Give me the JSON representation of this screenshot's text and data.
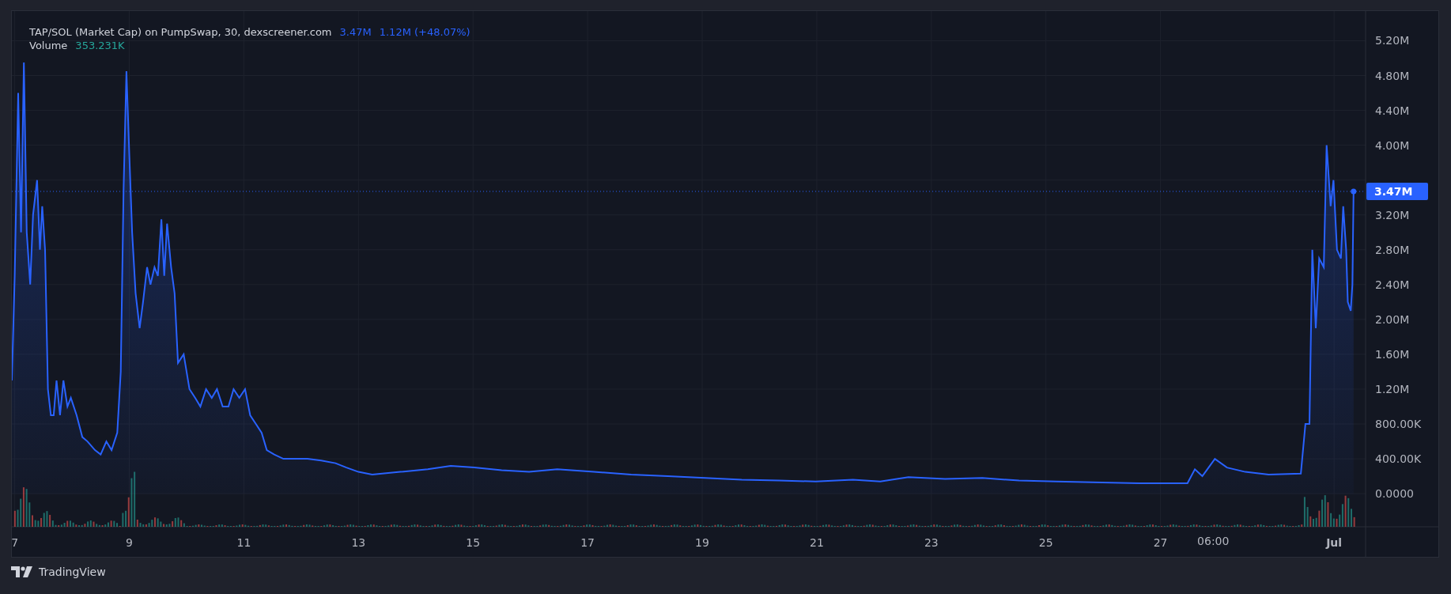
{
  "legend": {
    "title": "TAP/SOL (Market Cap) on PumpSwap, 30, dexscreener.com",
    "last_value": "3.47M",
    "change": "1.12M (+48.07%)",
    "volume_label": "Volume",
    "volume_value": "353.231K"
  },
  "chart": {
    "price_badge": "3.47M",
    "session_label": "06:00",
    "chart_data": {
      "type": "area",
      "grid": true,
      "xlim": [
        6.95,
        31.85
      ],
      "ylim": [
        -380000,
        5540000
      ],
      "x": [
        6.95,
        7,
        7.06,
        7.11,
        7.16,
        7.21,
        7.27,
        7.32,
        7.39,
        7.44,
        7.48,
        7.53,
        7.58,
        7.63,
        7.68,
        7.73,
        7.79,
        7.85,
        7.92,
        7.98,
        8.08,
        8.18,
        8.27,
        8.4,
        8.5,
        8.6,
        8.69,
        8.79,
        8.85,
        8.9,
        8.95,
        9,
        9.05,
        9.11,
        9.18,
        9.24,
        9.31,
        9.37,
        9.44,
        9.5,
        9.56,
        9.61,
        9.66,
        9.73,
        9.79,
        9.85,
        9.95,
        10.05,
        10.15,
        10.24,
        10.34,
        10.44,
        10.53,
        10.63,
        10.73,
        10.82,
        10.92,
        11.02,
        11.11,
        11.21,
        11.31,
        11.4,
        11.53,
        11.69,
        11.89,
        12.11,
        12.35,
        12.6,
        12.79,
        13,
        13.24,
        13.73,
        14.21,
        14.61,
        15.02,
        15.5,
        15.98,
        16.47,
        17.11,
        17.76,
        18.4,
        19.05,
        19.69,
        20.34,
        20.98,
        21.63,
        22.11,
        22.6,
        23.24,
        23.89,
        24.53,
        25.18,
        25.82,
        26.63,
        27.47,
        27.6,
        27.73,
        27.95,
        28.16,
        28.48,
        28.89,
        29.45,
        29.53,
        29.6,
        29.65,
        29.71,
        29.77,
        29.85,
        29.9,
        29.97,
        30.02,
        30.08,
        30.15,
        30.19,
        30.24,
        30.27,
        30.32,
        30.35,
        30.37
      ],
      "series": [
        {
          "color": "#2962ff",
          "values": [
            1300000,
            2500000,
            4600000,
            3000000,
            4950000,
            3000000,
            2400000,
            3200000,
            3600000,
            2800000,
            3300000,
            2800000,
            1200000,
            900000,
            900000,
            1300000,
            900000,
            1300000,
            1000000,
            1100000,
            900000,
            650000,
            600000,
            500000,
            450000,
            600000,
            500000,
            700000,
            1400000,
            3500000,
            4850000,
            3900000,
            3000000,
            2300000,
            1900000,
            2200000,
            2600000,
            2400000,
            2600000,
            2500000,
            3150000,
            2500000,
            3100000,
            2600000,
            2300000,
            1500000,
            1600000,
            1200000,
            1100000,
            1000000,
            1200000,
            1100000,
            1200000,
            1000000,
            1000000,
            1200000,
            1100000,
            1200000,
            900000,
            800000,
            700000,
            500000,
            450000,
            400000,
            400000,
            400000,
            380000,
            350000,
            300000,
            250000,
            220000,
            250000,
            280000,
            320000,
            300000,
            270000,
            250000,
            280000,
            250000,
            220000,
            200000,
            180000,
            160000,
            150000,
            140000,
            160000,
            140000,
            190000,
            170000,
            180000,
            150000,
            140000,
            130000,
            120000,
            120000,
            280000,
            200000,
            400000,
            300000,
            250000,
            220000,
            230000,
            800000,
            800000,
            2800000,
            1900000,
            2700000,
            2600000,
            4000000,
            3300000,
            3600000,
            2800000,
            2700000,
            3300000,
            2800000,
            2200000,
            2100000,
            2400000,
            3470000
          ]
        }
      ],
      "xticks": [
        {
          "value": 7,
          "label": "7"
        },
        {
          "value": 9,
          "label": "9"
        },
        {
          "value": 11,
          "label": "11"
        },
        {
          "value": 13,
          "label": "13"
        },
        {
          "value": 15,
          "label": "15"
        },
        {
          "value": 17,
          "label": "17"
        },
        {
          "value": 19,
          "label": "19"
        },
        {
          "value": 21,
          "label": "21"
        },
        {
          "value": 23,
          "label": "23"
        },
        {
          "value": 25,
          "label": "25"
        },
        {
          "value": 27,
          "label": "27"
        },
        {
          "value": 30.03,
          "label": "Jul"
        }
      ],
      "yticks": [
        {
          "value": 5200000,
          "label": "5.20M"
        },
        {
          "value": 4800000,
          "label": "4.80M"
        },
        {
          "value": 4400000,
          "label": "4.40M"
        },
        {
          "value": 4000000,
          "label": "4.00M"
        },
        {
          "value": 3200000,
          "label": "3.20M"
        },
        {
          "value": 2800000,
          "label": "2.80M"
        },
        {
          "value": 2400000,
          "label": "2.40M"
        },
        {
          "value": 2000000,
          "label": "2.00M"
        },
        {
          "value": 1600000,
          "label": "1.60M"
        },
        {
          "value": 1200000,
          "label": "1.20M"
        },
        {
          "value": 800000,
          "label": "800.00K"
        },
        {
          "value": 400000,
          "label": "400.00K"
        },
        {
          "value": 0,
          "label": "0.0000"
        }
      ]
    }
  },
  "footer": {
    "brand": "TradingView"
  }
}
